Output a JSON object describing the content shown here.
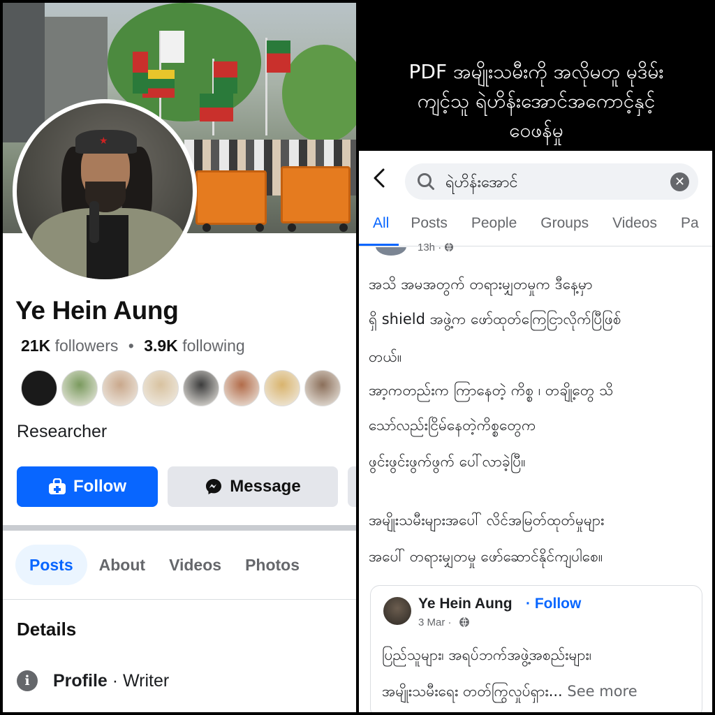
{
  "headline": {
    "line1": "PDF အမျိုးသမီးကို အလိုမတူ မုဒိမ်း",
    "line2": "ကျင့်သူ ရဲဟိန်းအောင်အကောင့်နှင့်",
    "line3": "ဝေဖန်မှု"
  },
  "profile": {
    "name": "Ye Hein Aung",
    "followers_count": "21K",
    "followers_label": "followers",
    "separator": "•",
    "following_count": "3.9K",
    "following_label": "following",
    "bio": "Researcher",
    "follow_label": "Follow",
    "message_label": "Message",
    "tabs": [
      "Posts",
      "About",
      "Videos",
      "Photos"
    ],
    "details_title": "Details",
    "profile_label": "Profile",
    "profile_value": "· Writer",
    "friend_avatars": [
      "#1a1a1a",
      "#7a9a5e",
      "#c9a88c",
      "#d8c2a0",
      "#3c3c3c",
      "#b26c4a",
      "#d9b46e",
      "#8b6f5a"
    ]
  },
  "search": {
    "query": "ရဲဟိန်းအောင်",
    "tabs": [
      "All",
      "Posts",
      "People",
      "Groups",
      "Videos",
      "Pa"
    ],
    "active_tab": "All"
  },
  "post": {
    "time": "13h ·",
    "lines": [
      "အသိ အမအတွက် တရားမျှတမှုက ဒီနေ့မှာ",
      "ရှိ shield အဖွဲ့က ဖော်ထုတ်ကြေငြာလိုက်ပြီဖြစ်",
      "တယ်။",
      "အာ့ကတည်းက ကြာနေတဲ့ ကိစ္စ ၊ တချို့တွေ သိ",
      "သော်လည်းငြိမ်နေတဲ့ကိစ္စတွေက",
      "ဖွင်းဖွင်းဖွက်ဖွက် ပေါ်လာခဲ့ပြီ။",
      "အမျိုးသမီးများအပေါ် လိင်အမြတ်ထုတ်မှုများ",
      "အပေါ် တရားမျှတမှု ဖော်ဆောင်နိုင်ကျပါစေ။"
    ],
    "shared": {
      "name": "Ye Hein Aung",
      "follow": "· Follow",
      "date": "3 Mar ·",
      "line1": "ပြည်သူများ၊ အရပ်ဘက်အဖွဲ့အစည်းများ၊",
      "line2": "အမျိုးသမီးရေး တတ်ကြွလှုပ်ရှား...",
      "see_more": " See more"
    }
  },
  "colors": {
    "facebook_blue": "#0866ff",
    "muted_text": "#65676b",
    "button_grey": "#e4e6eb"
  }
}
